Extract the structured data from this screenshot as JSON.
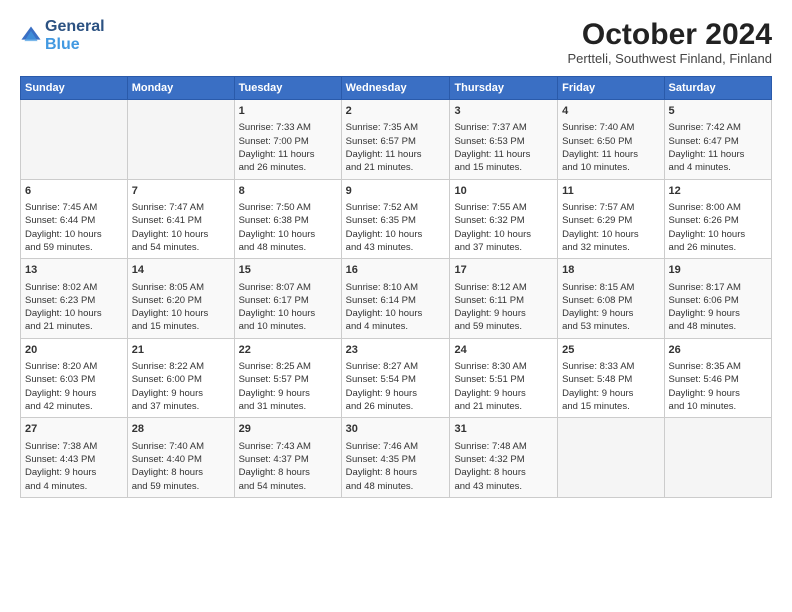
{
  "header": {
    "logo_line1": "General",
    "logo_line2": "Blue",
    "title": "October 2024",
    "subtitle": "Pertteli, Southwest Finland, Finland"
  },
  "weekdays": [
    "Sunday",
    "Monday",
    "Tuesday",
    "Wednesday",
    "Thursday",
    "Friday",
    "Saturday"
  ],
  "weeks": [
    [
      {
        "day": "",
        "info": ""
      },
      {
        "day": "",
        "info": ""
      },
      {
        "day": "1",
        "info": "Sunrise: 7:33 AM\nSunset: 7:00 PM\nDaylight: 11 hours\nand 26 minutes."
      },
      {
        "day": "2",
        "info": "Sunrise: 7:35 AM\nSunset: 6:57 PM\nDaylight: 11 hours\nand 21 minutes."
      },
      {
        "day": "3",
        "info": "Sunrise: 7:37 AM\nSunset: 6:53 PM\nDaylight: 11 hours\nand 15 minutes."
      },
      {
        "day": "4",
        "info": "Sunrise: 7:40 AM\nSunset: 6:50 PM\nDaylight: 11 hours\nand 10 minutes."
      },
      {
        "day": "5",
        "info": "Sunrise: 7:42 AM\nSunset: 6:47 PM\nDaylight: 11 hours\nand 4 minutes."
      }
    ],
    [
      {
        "day": "6",
        "info": "Sunrise: 7:45 AM\nSunset: 6:44 PM\nDaylight: 10 hours\nand 59 minutes."
      },
      {
        "day": "7",
        "info": "Sunrise: 7:47 AM\nSunset: 6:41 PM\nDaylight: 10 hours\nand 54 minutes."
      },
      {
        "day": "8",
        "info": "Sunrise: 7:50 AM\nSunset: 6:38 PM\nDaylight: 10 hours\nand 48 minutes."
      },
      {
        "day": "9",
        "info": "Sunrise: 7:52 AM\nSunset: 6:35 PM\nDaylight: 10 hours\nand 43 minutes."
      },
      {
        "day": "10",
        "info": "Sunrise: 7:55 AM\nSunset: 6:32 PM\nDaylight: 10 hours\nand 37 minutes."
      },
      {
        "day": "11",
        "info": "Sunrise: 7:57 AM\nSunset: 6:29 PM\nDaylight: 10 hours\nand 32 minutes."
      },
      {
        "day": "12",
        "info": "Sunrise: 8:00 AM\nSunset: 6:26 PM\nDaylight: 10 hours\nand 26 minutes."
      }
    ],
    [
      {
        "day": "13",
        "info": "Sunrise: 8:02 AM\nSunset: 6:23 PM\nDaylight: 10 hours\nand 21 minutes."
      },
      {
        "day": "14",
        "info": "Sunrise: 8:05 AM\nSunset: 6:20 PM\nDaylight: 10 hours\nand 15 minutes."
      },
      {
        "day": "15",
        "info": "Sunrise: 8:07 AM\nSunset: 6:17 PM\nDaylight: 10 hours\nand 10 minutes."
      },
      {
        "day": "16",
        "info": "Sunrise: 8:10 AM\nSunset: 6:14 PM\nDaylight: 10 hours\nand 4 minutes."
      },
      {
        "day": "17",
        "info": "Sunrise: 8:12 AM\nSunset: 6:11 PM\nDaylight: 9 hours\nand 59 minutes."
      },
      {
        "day": "18",
        "info": "Sunrise: 8:15 AM\nSunset: 6:08 PM\nDaylight: 9 hours\nand 53 minutes."
      },
      {
        "day": "19",
        "info": "Sunrise: 8:17 AM\nSunset: 6:06 PM\nDaylight: 9 hours\nand 48 minutes."
      }
    ],
    [
      {
        "day": "20",
        "info": "Sunrise: 8:20 AM\nSunset: 6:03 PM\nDaylight: 9 hours\nand 42 minutes."
      },
      {
        "day": "21",
        "info": "Sunrise: 8:22 AM\nSunset: 6:00 PM\nDaylight: 9 hours\nand 37 minutes."
      },
      {
        "day": "22",
        "info": "Sunrise: 8:25 AM\nSunset: 5:57 PM\nDaylight: 9 hours\nand 31 minutes."
      },
      {
        "day": "23",
        "info": "Sunrise: 8:27 AM\nSunset: 5:54 PM\nDaylight: 9 hours\nand 26 minutes."
      },
      {
        "day": "24",
        "info": "Sunrise: 8:30 AM\nSunset: 5:51 PM\nDaylight: 9 hours\nand 21 minutes."
      },
      {
        "day": "25",
        "info": "Sunrise: 8:33 AM\nSunset: 5:48 PM\nDaylight: 9 hours\nand 15 minutes."
      },
      {
        "day": "26",
        "info": "Sunrise: 8:35 AM\nSunset: 5:46 PM\nDaylight: 9 hours\nand 10 minutes."
      }
    ],
    [
      {
        "day": "27",
        "info": "Sunrise: 7:38 AM\nSunset: 4:43 PM\nDaylight: 9 hours\nand 4 minutes."
      },
      {
        "day": "28",
        "info": "Sunrise: 7:40 AM\nSunset: 4:40 PM\nDaylight: 8 hours\nand 59 minutes."
      },
      {
        "day": "29",
        "info": "Sunrise: 7:43 AM\nSunset: 4:37 PM\nDaylight: 8 hours\nand 54 minutes."
      },
      {
        "day": "30",
        "info": "Sunrise: 7:46 AM\nSunset: 4:35 PM\nDaylight: 8 hours\nand 48 minutes."
      },
      {
        "day": "31",
        "info": "Sunrise: 7:48 AM\nSunset: 4:32 PM\nDaylight: 8 hours\nand 43 minutes."
      },
      {
        "day": "",
        "info": ""
      },
      {
        "day": "",
        "info": ""
      }
    ]
  ]
}
